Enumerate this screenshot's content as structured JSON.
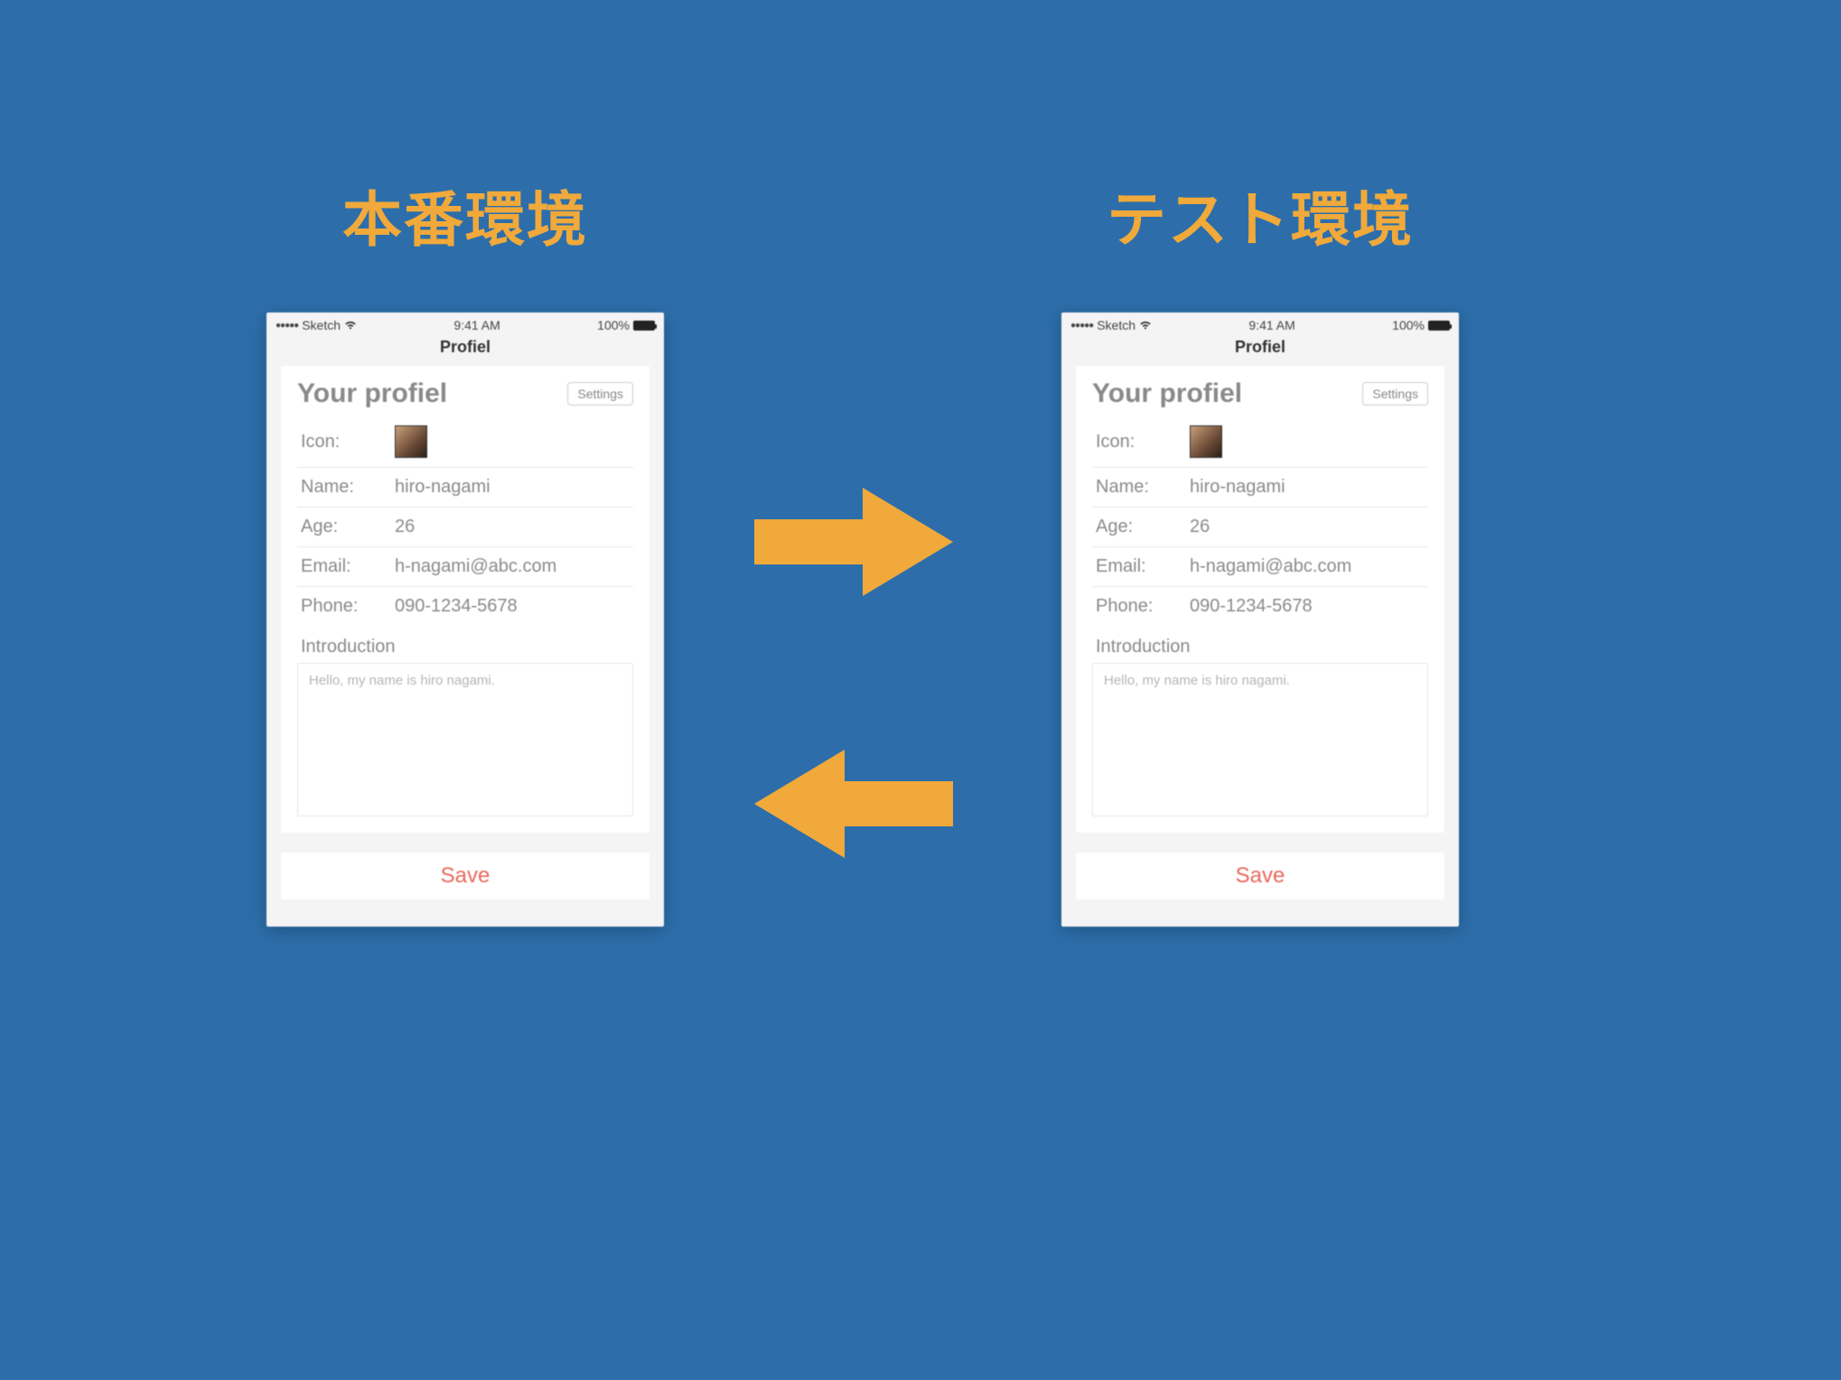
{
  "colors": {
    "bg": "#2d6eaa",
    "accent": "#f0a93a",
    "save": "#e86a5c"
  },
  "left_title": "本番環境",
  "right_title": "テスト環境",
  "phone": {
    "status": {
      "carrier": "Sketch",
      "time": "9:41 AM",
      "battery": "100%"
    },
    "nav_title": "Profiel",
    "header": "Your profiel",
    "settings_label": "Settings",
    "fields": {
      "icon_label": "Icon:",
      "name_label": "Name:",
      "name_value": "hiro-nagami",
      "age_label": "Age:",
      "age_value": "26",
      "email_label": "Email:",
      "email_value": "h-nagami@abc.com",
      "phone_label": "Phone:",
      "phone_value": "090-1234-5678"
    },
    "intro_label": "Introduction",
    "intro_value": "Hello, my name is hiro nagami.",
    "save_label": "Save"
  }
}
